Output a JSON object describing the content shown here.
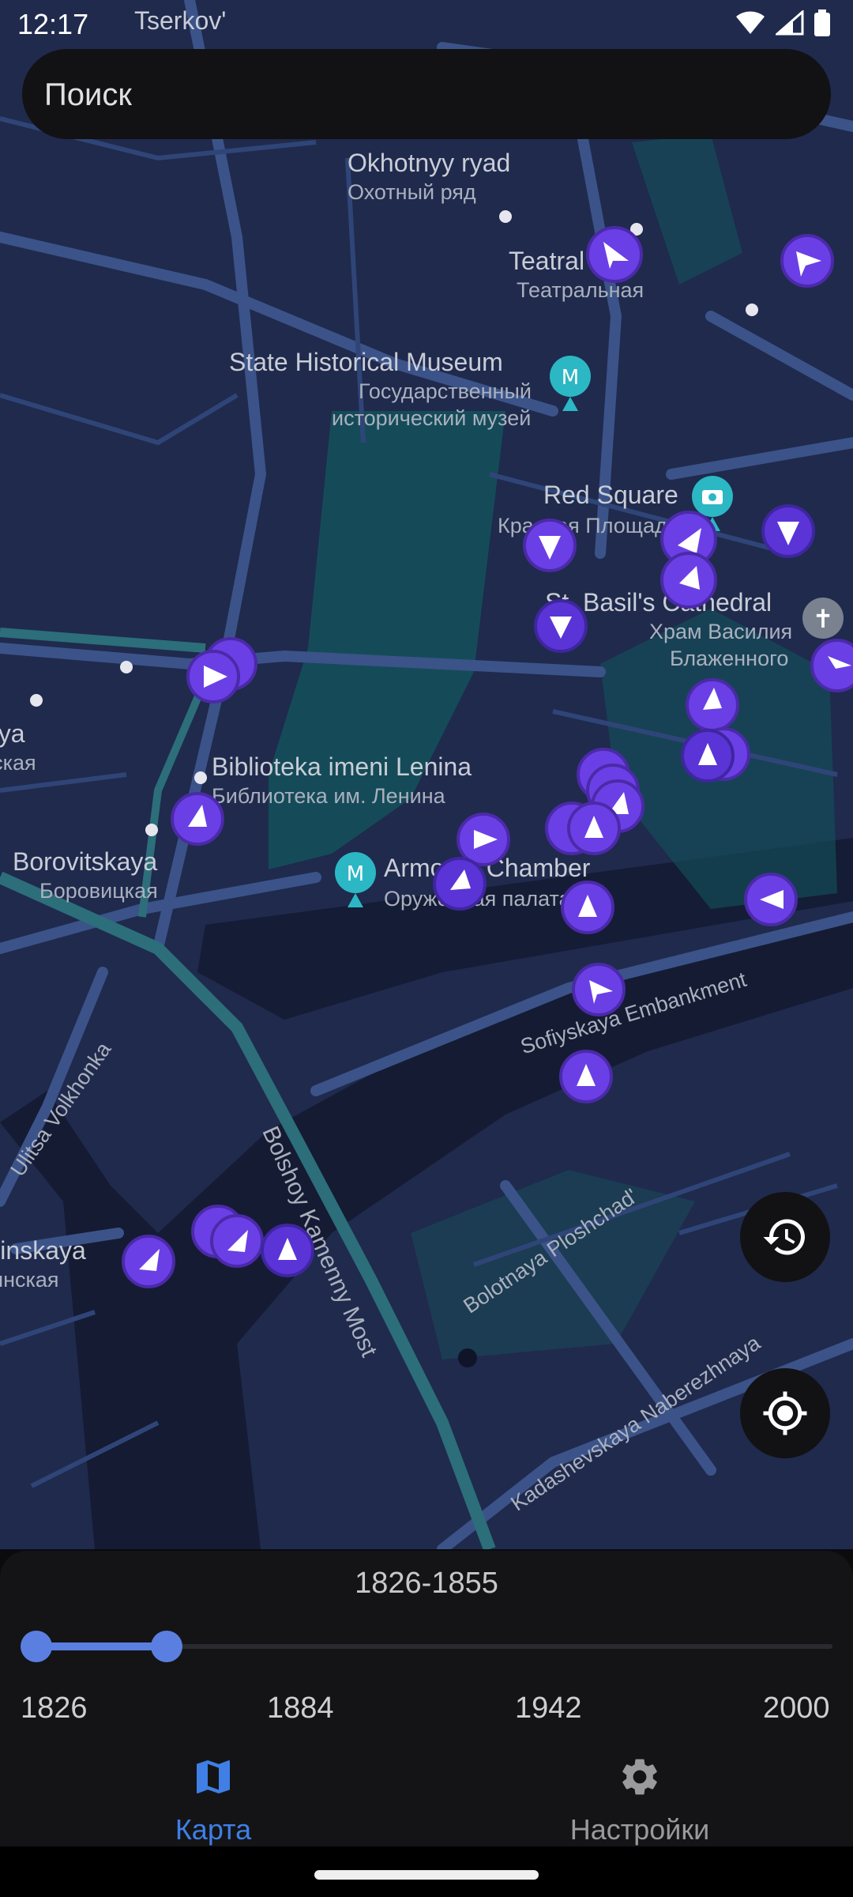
{
  "status": {
    "time": "12:17"
  },
  "search": {
    "placeholder": "Поиск"
  },
  "map": {
    "labels": {
      "okhotnyy": "Okhotnyy ryad",
      "okhotnyy_ru": "Охотный ряд",
      "teatral": "Teatral",
      "teatral_ru": "Театральная",
      "museum": "State Historical Museum",
      "museum_ru1": "Государственный",
      "museum_ru2": "исторический музей",
      "redsquare": "Red Square",
      "redsquare_ru": "Красная Площадь",
      "basils": "St. Basil's Cathedral",
      "basils_ru1": "Храм Василия",
      "basils_ru2": "Блаженного",
      "biblioteka": "Biblioteka imeni Lenina",
      "biblioteka_ru": "Библиотека им. Ленина",
      "borovitskaya": "Borovitskaya",
      "borovitskaya_ru": "Боровицкая",
      "armoury": "Armoury Chamber",
      "armoury_ru": "Оружейная палата",
      "sofiyskaya": "Sofiyskaya Embankment",
      "volkhonka": "Ulitsa Volkhonka",
      "kamenny": "Bolshoy Kamenny Most",
      "bolotnaya": "Bolotnaya Ploshchad'",
      "kadashevskaya": "Kadashevskaya Naberezhnaya",
      "kropotkinskaya": "Kropotkinskaya",
      "kropotkinskaya_ru": "Кропоткинская",
      "tserkov": "Tserkov'",
      "kaya": "kaya",
      "kaya_ru": "тская"
    }
  },
  "timeline": {
    "selected_range": "1826-1855",
    "min": 1826,
    "max": 2000,
    "range_start": 1826,
    "range_end": 1855,
    "ticks": [
      "1826",
      "1884",
      "1942",
      "2000"
    ]
  },
  "buttons": {
    "history_icon": "history-icon",
    "locate_icon": "my-location-icon"
  },
  "nav": {
    "map_label": "Карта",
    "settings_label": "Настройки",
    "active": "map",
    "active_color": "#3f7fe6",
    "inactive_color": "#9a9a9a"
  },
  "colors": {
    "marker": "#6b3fe6",
    "map_bg": "#1f2a4d",
    "water": "#141b33",
    "park": "#13545c"
  }
}
